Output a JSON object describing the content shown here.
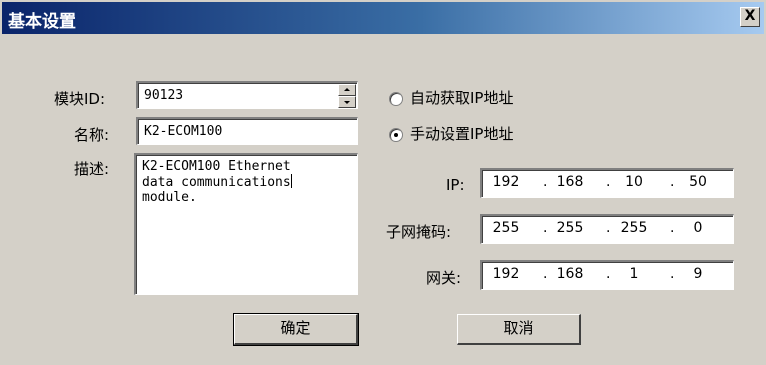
{
  "window": {
    "title": "基本设置",
    "close_label": "X"
  },
  "form": {
    "module_id_label": "模块ID:",
    "module_id_value": "90123",
    "name_label": "名称:",
    "name_value": "K2-ECOM100",
    "desc_label": "描述:",
    "desc_lines": [
      "K2-ECOM100 Ethernet",
      "data communications",
      "module."
    ]
  },
  "network": {
    "auto_ip_label": "自动获取IP地址",
    "manual_ip_label": "手动设置IP地址",
    "selected": "manual",
    "ip_label": "IP:",
    "ip": [
      "192",
      "168",
      "10",
      "50"
    ],
    "mask_label": "子网掩码:",
    "mask": [
      "255",
      "255",
      "255",
      "0"
    ],
    "gateway_label": "网关:",
    "gateway": [
      "192",
      "168",
      "1",
      "9"
    ],
    "separator": "."
  },
  "buttons": {
    "ok_label": "确定",
    "cancel_label": "取消"
  }
}
